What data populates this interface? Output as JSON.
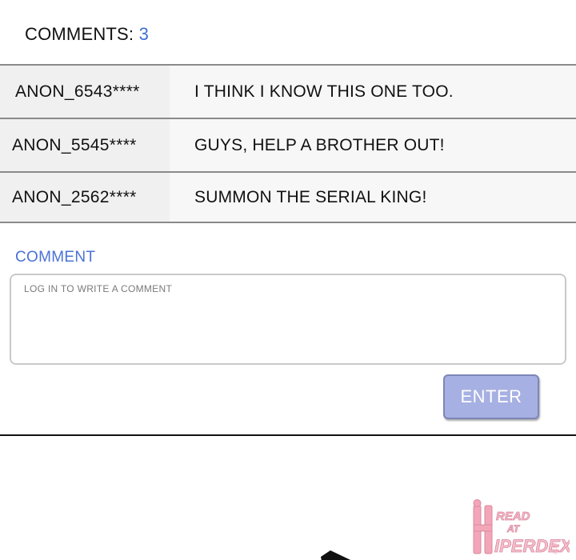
{
  "comments_header": {
    "label": "COMMENTS: ",
    "count": "3"
  },
  "comments": [
    {
      "user": "ANON_6543****",
      "text": "I THINK I KNOW THIS ONE TOO."
    },
    {
      "user": "ANON_5545****",
      "text": "GUYS, HELP A BROTHER OUT!"
    },
    {
      "user": "ANON_2562****",
      "text": "SUMMON THE SERIAL KING!"
    }
  ],
  "compose": {
    "label": "COMMENT",
    "placeholder": "LOG IN TO WRITE A COMMENT",
    "submit_label": "ENTER"
  },
  "watermark": {
    "logo_text": "READ AT HIPERDEX.COM"
  },
  "colors": {
    "accent_blue": "#4a72d6",
    "button_fill": "#a7b0e2",
    "watermark_pink": "#f2a6b8"
  }
}
